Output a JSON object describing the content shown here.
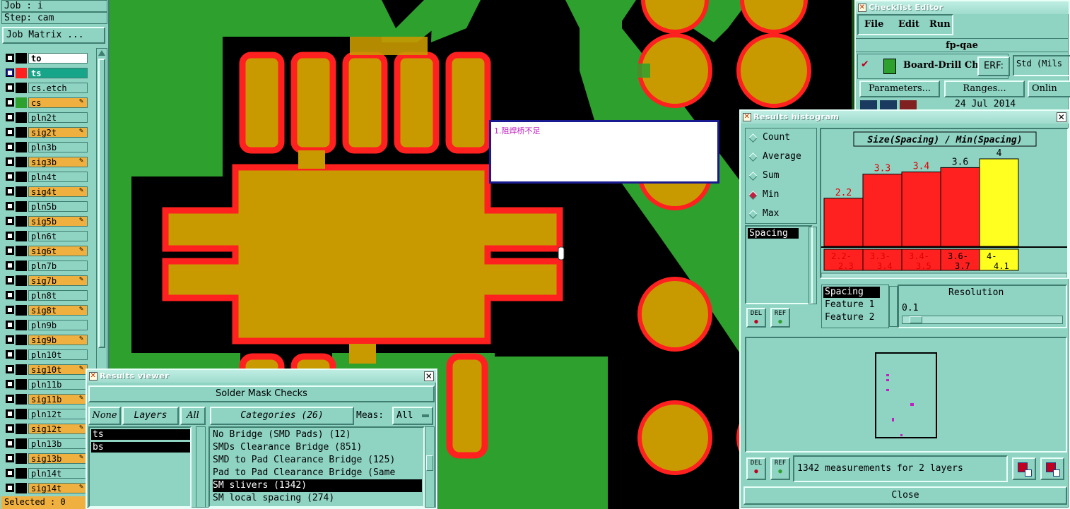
{
  "left_panel": {
    "job_label": "Job : i",
    "step_label": "Step: cam",
    "job_matrix_button": "Job Matrix ...",
    "layers": [
      {
        "name": "to",
        "type": "plain",
        "swatch": "#000000",
        "white": true
      },
      {
        "name": "ts",
        "type": "active",
        "swatch": "#ff2020"
      },
      {
        "name": "cs.etch",
        "type": "plain",
        "swatch": "#000000"
      },
      {
        "name": "cs",
        "type": "sig",
        "swatch": "#2ea02e"
      },
      {
        "name": "pln2t",
        "type": "plain",
        "swatch": "#000000"
      },
      {
        "name": "sig2t",
        "type": "sig",
        "swatch": "#000000"
      },
      {
        "name": "pln3b",
        "type": "plain",
        "swatch": "#000000"
      },
      {
        "name": "sig3b",
        "type": "sig",
        "swatch": "#000000"
      },
      {
        "name": "pln4t",
        "type": "plain",
        "swatch": "#000000"
      },
      {
        "name": "sig4t",
        "type": "sig",
        "swatch": "#000000"
      },
      {
        "name": "pln5b",
        "type": "plain",
        "swatch": "#000000"
      },
      {
        "name": "sig5b",
        "type": "sig",
        "swatch": "#000000"
      },
      {
        "name": "pln6t",
        "type": "plain",
        "swatch": "#000000"
      },
      {
        "name": "sig6t",
        "type": "sig",
        "swatch": "#000000"
      },
      {
        "name": "pln7b",
        "type": "plain",
        "swatch": "#000000"
      },
      {
        "name": "sig7b",
        "type": "sig",
        "swatch": "#000000"
      },
      {
        "name": "pln8t",
        "type": "plain",
        "swatch": "#000000"
      },
      {
        "name": "sig8t",
        "type": "sig",
        "swatch": "#000000"
      },
      {
        "name": "pln9b",
        "type": "plain",
        "swatch": "#000000"
      },
      {
        "name": "sig9b",
        "type": "sig",
        "swatch": "#000000"
      },
      {
        "name": "pln10t",
        "type": "plain",
        "swatch": "#000000"
      },
      {
        "name": "sig10t",
        "type": "sig",
        "swatch": "#000000"
      },
      {
        "name": "pln11b",
        "type": "plain",
        "swatch": "#000000"
      },
      {
        "name": "sig11b",
        "type": "sig",
        "swatch": "#000000"
      },
      {
        "name": "pln12t",
        "type": "plain",
        "swatch": "#000000"
      },
      {
        "name": "sig12t",
        "type": "sig",
        "swatch": "#000000"
      },
      {
        "name": "pln13b",
        "type": "plain",
        "swatch": "#000000"
      },
      {
        "name": "sig13b",
        "type": "sig",
        "swatch": "#000000"
      },
      {
        "name": "pln14t",
        "type": "plain",
        "swatch": "#000000"
      },
      {
        "name": "sig14t",
        "type": "sig",
        "swatch": "#000000"
      }
    ],
    "selected_label": "Selected : 0"
  },
  "canvas": {
    "note_text": "1.阻焊桥不足"
  },
  "checklist_editor": {
    "title": "Checklist Editor",
    "menu": [
      "File",
      "Edit",
      "Run"
    ],
    "checklist_name": "fp-qae",
    "check_name": "Board-Drill Che",
    "erf_label": "ERF:",
    "erf_value": "Std (Mils",
    "parameters_button": "Parameters...",
    "ranges_button": "Ranges...",
    "online_button": "Onlin",
    "date": "24 Jul 2014"
  },
  "histogram": {
    "title": "Results histogram",
    "options": [
      "Count",
      "Average",
      "Sum",
      "Min",
      "Max"
    ],
    "selected_option": "Min",
    "list_item": "Spacing",
    "chart_title": "Size(Spacing) / Min(Spacing)",
    "resolution_label": "Resolution",
    "resolution_value": "0.1",
    "fields": [
      "Spacing",
      "Feature 1",
      "Feature 2"
    ],
    "measurements_text": "1342 measurements for 2 layers",
    "close_button": "Close",
    "del_label": "DEL",
    "ref_label": "REF"
  },
  "chart_data": {
    "type": "bar",
    "title": "Size(Spacing) / Min(Spacing)",
    "categories": [
      "2.2- 2.3",
      "3.3- 3.4",
      "3.4- 3.5",
      "3.6- 3.7",
      "4- 4.1"
    ],
    "values": [
      2.2,
      3.3,
      3.4,
      3.6,
      4
    ],
    "value_labels": [
      "2.2",
      "3.3",
      "3.4",
      "3.6",
      "4"
    ],
    "category_top": [
      "2.2-",
      "3.3-",
      "3.4-",
      "3.6-",
      "4-"
    ],
    "category_bottom": [
      "2.3",
      "3.4",
      "3.5",
      "3.7",
      "4.1"
    ],
    "colors": [
      "#ff2020",
      "#ff2020",
      "#ff2020",
      "#ff2020",
      "#ffff20"
    ],
    "label_colors": [
      "#e00000",
      "#e00000",
      "#e00000",
      "#000000",
      "#000000"
    ],
    "ylim": [
      0,
      4
    ]
  },
  "results_viewer": {
    "title": "Results viewer",
    "header": "Solder Mask Checks",
    "none_button": "None",
    "layers_button": "Layers",
    "all_button": "All",
    "categories_button": "Categories (26)",
    "meas_label": "Meas:",
    "meas_value": "All",
    "layers": [
      "ts",
      "bs"
    ],
    "categories": [
      "No Bridge (SMD Pads) (12)",
      "SMDs Clearance Bridge (851)",
      "SMD to Pad Clearance Bridge (125)",
      "Pad to Pad Clearance Bridge (Same",
      "SM slivers (1342)",
      "SM local spacing (274)"
    ],
    "selected_category_index": 4
  }
}
